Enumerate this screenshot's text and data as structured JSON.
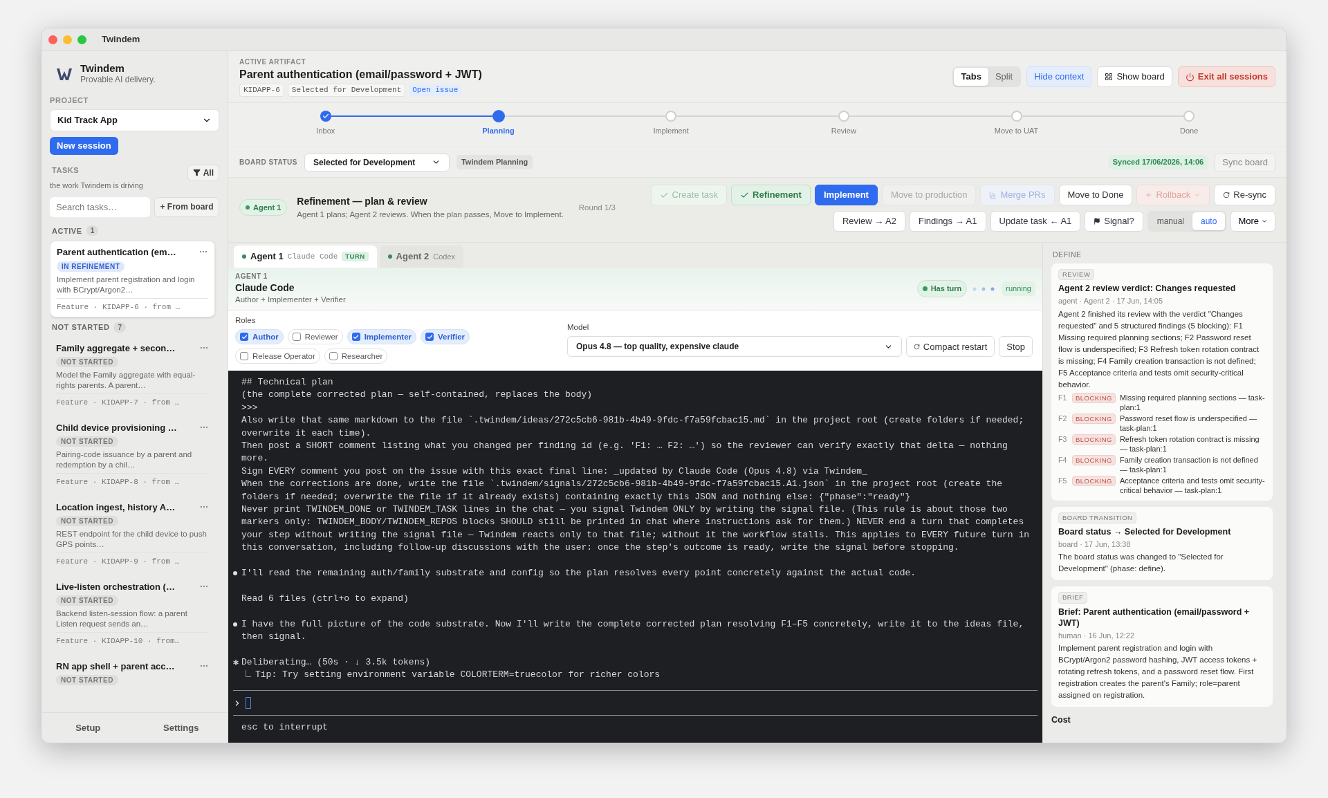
{
  "window": {
    "title": "Twindem"
  },
  "sidebar": {
    "brand": "Twindem",
    "tagline": "Provable AI delivery.",
    "project_label": "PROJECT",
    "project": "Kid Track App",
    "new_session": "New session",
    "tasks_label": "TASKS",
    "tasks_sub": "the work Twindem is driving",
    "filter": "All",
    "search_placeholder": "Search tasks…",
    "from_board": "+ From board",
    "groups": [
      {
        "title": "ACTIVE",
        "count": "1",
        "tasks": [
          {
            "title": "Parent authentication (em…",
            "status": "IN REFINEMENT",
            "kind": "refinement",
            "selected": true,
            "description": "Implement parent registration and login with BCrypt/Argon2…",
            "meta": "Feature · KIDAPP-6 · from …"
          }
        ]
      },
      {
        "title": "NOT STARTED",
        "count": "7",
        "tasks": [
          {
            "title": "Family aggregate + secon…",
            "status": "NOT STARTED",
            "kind": "not_started",
            "selected": false,
            "description": "Model the Family aggregate with equal-rights parents. A parent…",
            "meta": "Feature · KIDAPP-7 · from …"
          },
          {
            "title": "Child device provisioning …",
            "status": "NOT STARTED",
            "kind": "not_started",
            "selected": false,
            "description": "Pairing-code issuance by a parent and redemption by a chil…",
            "meta": "Feature · KIDAPP-8 · from …"
          },
          {
            "title": "Location ingest, history A…",
            "status": "NOT STARTED",
            "kind": "not_started",
            "selected": false,
            "description": "REST endpoint for the child device to push GPS points…",
            "meta": "Feature · KIDAPP-9 · from …"
          },
          {
            "title": "Live-listen orchestration (…",
            "status": "NOT STARTED",
            "kind": "not_started",
            "selected": false,
            "description": "Backend listen-session flow: a parent Listen request sends an…",
            "meta": "Feature · KIDAPP-10 · from…"
          },
          {
            "title": "RN app shell + parent acc…",
            "status": "NOT STARTED",
            "kind": "not_started",
            "selected": false
          }
        ]
      }
    ],
    "footer": [
      "Setup",
      "Settings"
    ]
  },
  "header": {
    "label": "ACTIVE ARTIFACT",
    "title": "Parent authentication (email/password + JWT)",
    "tags": [
      "KIDAPP-6",
      "Selected for Development"
    ],
    "link": "Open issue",
    "views": [
      {
        "label": "Tabs",
        "selected": true
      },
      {
        "label": "Split",
        "selected": false
      }
    ],
    "buttons": [
      {
        "label": "Hide context",
        "kind": "accent"
      },
      {
        "label": "Show board",
        "kind": "board"
      },
      {
        "label": "Exit all sessions",
        "kind": "danger"
      }
    ]
  },
  "stepper": [
    {
      "label": "Inbox",
      "done": true,
      "selected": false
    },
    {
      "label": "Planning",
      "done": false,
      "selected": true
    },
    {
      "label": "Implement",
      "done": false,
      "selected": false
    },
    {
      "label": "Review",
      "done": false,
      "selected": false
    },
    {
      "label": "Move to UAT",
      "done": false,
      "selected": false
    },
    {
      "label": "Done",
      "done": false,
      "selected": false
    }
  ],
  "board_status": {
    "label": "BOARD STATUS",
    "value": "Selected for Development",
    "tag": "Twindem Planning",
    "synced": "Synced 17/06/2026, 14:06",
    "sync_button": "Sync board"
  },
  "phase": {
    "agent": "Agent 1",
    "title": "Refinement — plan & review",
    "subtitle": "Agent 1 plans; Agent 2 reviews. When the plan passes, Move to Implement.",
    "round": "Round 1/3",
    "actions": [
      {
        "label": "Create task",
        "kind": "done"
      },
      {
        "label": "Refinement",
        "kind": "passed"
      },
      {
        "label": "Implement",
        "kind": "primary"
      },
      {
        "label": "Move to production",
        "kind": "disabled"
      },
      {
        "label": "Merge PRs",
        "kind": "merge"
      },
      {
        "label": "Move to Done",
        "kind": "normal"
      },
      {
        "label": "Rollback",
        "kind": "rollback"
      },
      {
        "label": "Re-sync",
        "kind": "resync"
      }
    ],
    "handoffs": [
      {
        "label": "Review → A2",
        "kind": "normal"
      },
      {
        "label": "Findings → A1",
        "kind": "normal"
      },
      {
        "label": "Update task ← A1",
        "kind": "normal"
      },
      {
        "label": "Signal?",
        "kind": "signal"
      }
    ],
    "modes": [
      {
        "label": "manual",
        "selected": false
      },
      {
        "label": "auto",
        "selected": true
      }
    ],
    "more": "More"
  },
  "agent_tabs": [
    {
      "name": "Agent 1",
      "engine": "Claude Code",
      "badge": "TURN",
      "selected": true
    },
    {
      "name": "Agent 2",
      "engine": "Codex",
      "selected": false
    }
  ],
  "agent": {
    "label": "AGENT 1",
    "name": "Claude Code",
    "roles_text": "Author + Implementer + Verifier",
    "turn": "Has turn",
    "state": "running",
    "roles_label": "Roles",
    "roles": [
      {
        "label": "Author",
        "checked": true
      },
      {
        "label": "Reviewer",
        "checked": false
      },
      {
        "label": "Implementer",
        "checked": true
      },
      {
        "label": "Verifier",
        "checked": true
      },
      {
        "label": "Release Operator",
        "checked": false
      },
      {
        "label": "Researcher",
        "checked": false
      }
    ],
    "model_label": "Model",
    "model": "Opus 4.8 — top quality, expensive claude",
    "compact": "Compact restart",
    "stop": "Stop"
  },
  "terminal": {
    "lines": [
      {
        "kind": "text",
        "text": "## Technical plan"
      },
      {
        "kind": "text",
        "text": "(the complete corrected plan — self-contained, replaces the body)"
      },
      {
        "kind": "text",
        "text": ">>>"
      },
      {
        "kind": "text",
        "text": "Also write that same markdown to the file `.twindem/ideas/272c5cb6-981b-4b49-9fdc-f7a59fcbac15.md` in the project root (create folders if needed; overwrite it each time)."
      },
      {
        "kind": "text",
        "text": "Then post a SHORT comment listing what you changed per finding id (e.g. 'F1: … F2: …') so the reviewer can verify exactly that delta — nothing more."
      },
      {
        "kind": "text",
        "text": "Sign EVERY comment you post on the issue with this exact final line: _updated by Claude Code (Opus 4.8) via Twindem_"
      },
      {
        "kind": "text",
        "text": "When the corrections are done, write the file `.twindem/signals/272c5cb6-981b-4b49-9fdc-f7a59fcbac15.A1.json` in the project root (create the folders if needed; overwrite the file if it already exists) containing exactly this JSON and nothing else: {\"phase\":\"ready\"}"
      },
      {
        "kind": "text",
        "text": "Never print TWINDEM_DONE or TWINDEM_TASK lines in the chat — you signal Twindem ONLY by writing the signal file. (This rule is about those two markers only: TWINDEM_BODY/TWINDEM_REPOS blocks SHOULD still be printed in chat where instructions ask for them.) NEVER end a turn that completes your step without writing the signal file — Twindem reacts only to that file; without it the workflow stalls. This applies to EVERY future turn in this conversation, including follow-up discussions with the user: once the step's outcome is ready, write the signal before stopping."
      },
      {
        "kind": "blank"
      },
      {
        "kind": "bullet",
        "text": "I'll read the remaining auth/family substrate and config so the plan resolves every point concretely against the actual code."
      },
      {
        "kind": "blank"
      },
      {
        "kind": "text",
        "text": "Read 6 files (ctrl+o to expand)"
      },
      {
        "kind": "blank"
      },
      {
        "kind": "bullet",
        "text": "I have the full picture of the code substrate. Now I'll write the complete corrected plan resolving F1–F5 concretely, write it to the ideas file, then signal."
      },
      {
        "kind": "blank"
      },
      {
        "kind": "star",
        "text": "Deliberating… (50s · ↓ 3.5k tokens)"
      },
      {
        "kind": "tip",
        "text": "Tip: Try setting environment variable COLORTERM=truecolor for richer colors"
      }
    ],
    "hint": "esc to interrupt"
  },
  "context": {
    "section": "DEFINE",
    "cards": [
      {
        "tag": "REVIEW",
        "title": "Agent 2 review verdict: Changes requested",
        "meta": "agent · Agent 2 · 17 Jun, 14:05",
        "body": "Agent 2 finished its review with the verdict \"Changes requested\" and 5 structured findings (5 blocking): F1 Missing required planning sections; F2 Password reset flow is underspecified; F3 Refresh token rotation contract is missing; F4 Family creation transaction is not defined; F5 Acceptance criteria and tests omit security-critical behavior.",
        "findings": [
          {
            "id": "F1",
            "severity": "BLOCKING",
            "text": "Missing required planning sections — task-plan:1"
          },
          {
            "id": "F2",
            "severity": "BLOCKING",
            "text": "Password reset flow is underspecified — task-plan:1"
          },
          {
            "id": "F3",
            "severity": "BLOCKING",
            "text": "Refresh token rotation contract is missing — task-plan:1"
          },
          {
            "id": "F4",
            "severity": "BLOCKING",
            "text": "Family creation transaction is not defined — task-plan:1"
          },
          {
            "id": "F5",
            "severity": "BLOCKING",
            "text": "Acceptance criteria and tests omit security-critical behavior — task-plan:1"
          }
        ]
      },
      {
        "tag": "BOARD TRANSITION",
        "title": "Board status → Selected for Development",
        "meta": "board · 17 Jun, 13:38",
        "body": "The board status was changed to \"Selected for Development\" (phase: define)."
      },
      {
        "tag": "BRIEF",
        "title": "Brief: Parent authentication (email/password + JWT)",
        "meta": "human · 16 Jun, 12:22",
        "body": "Implement parent registration and login with BCrypt/Argon2 password hashing, JWT access tokens + rotating refresh tokens, and a password reset flow. First registration creates the parent's Family; role=parent assigned on registration."
      }
    ],
    "footer": "Cost"
  }
}
